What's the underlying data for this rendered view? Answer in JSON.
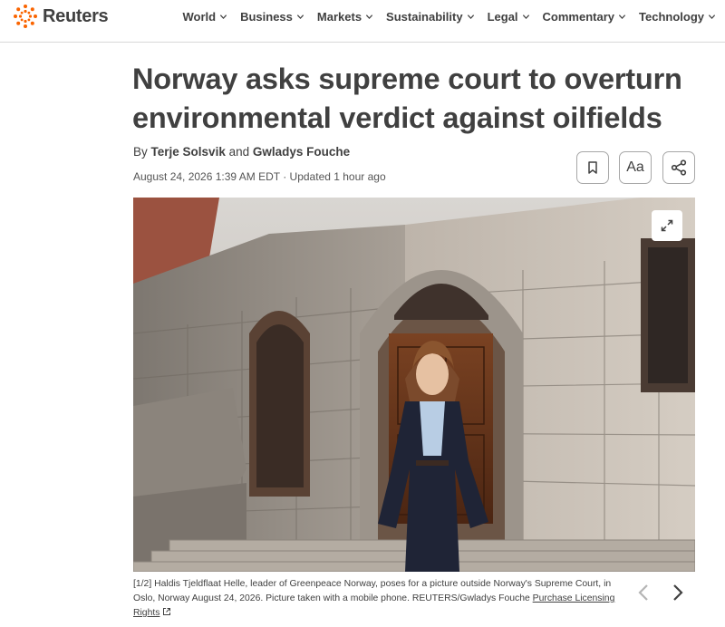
{
  "header": {
    "brand": "Reuters",
    "nav": [
      {
        "label": "World"
      },
      {
        "label": "Business"
      },
      {
        "label": "Markets"
      },
      {
        "label": "Sustainability"
      },
      {
        "label": "Legal"
      },
      {
        "label": "Commentary"
      },
      {
        "label": "Technology"
      }
    ]
  },
  "article": {
    "headline": "Norway asks supreme court to overturn environmental verdict against oilfields",
    "byline_prefix": "By",
    "author_1": "Terje Solsvik",
    "byline_and": "and",
    "author_2": "Gwladys Fouche",
    "dateline": "August 24, 2026 1:39 AM EDT · Updated 1 hour ago",
    "tools": {
      "bookmark_icon": "bookmark-icon",
      "text_size_label": "Aa",
      "share_icon": "share-icon"
    }
  },
  "photo": {
    "expand_icon": "expand-icon",
    "caption": "[1/2] Haldis Tjeldflaat Helle, leader of Greenpeace Norway, poses for a picture outside Norway's Supreme Court, in Oslo, Norway August 24, 2026. Picture taken with a mobile phone. REUTERS/Gwladys Fouche",
    "license_link": "Purchase Licensing Rights",
    "prev_icon": "chevron-left-icon",
    "next_icon": "chevron-right-icon"
  },
  "colors": {
    "brand_orange": "#fa6400",
    "text": "#404040",
    "muted": "#555555"
  }
}
